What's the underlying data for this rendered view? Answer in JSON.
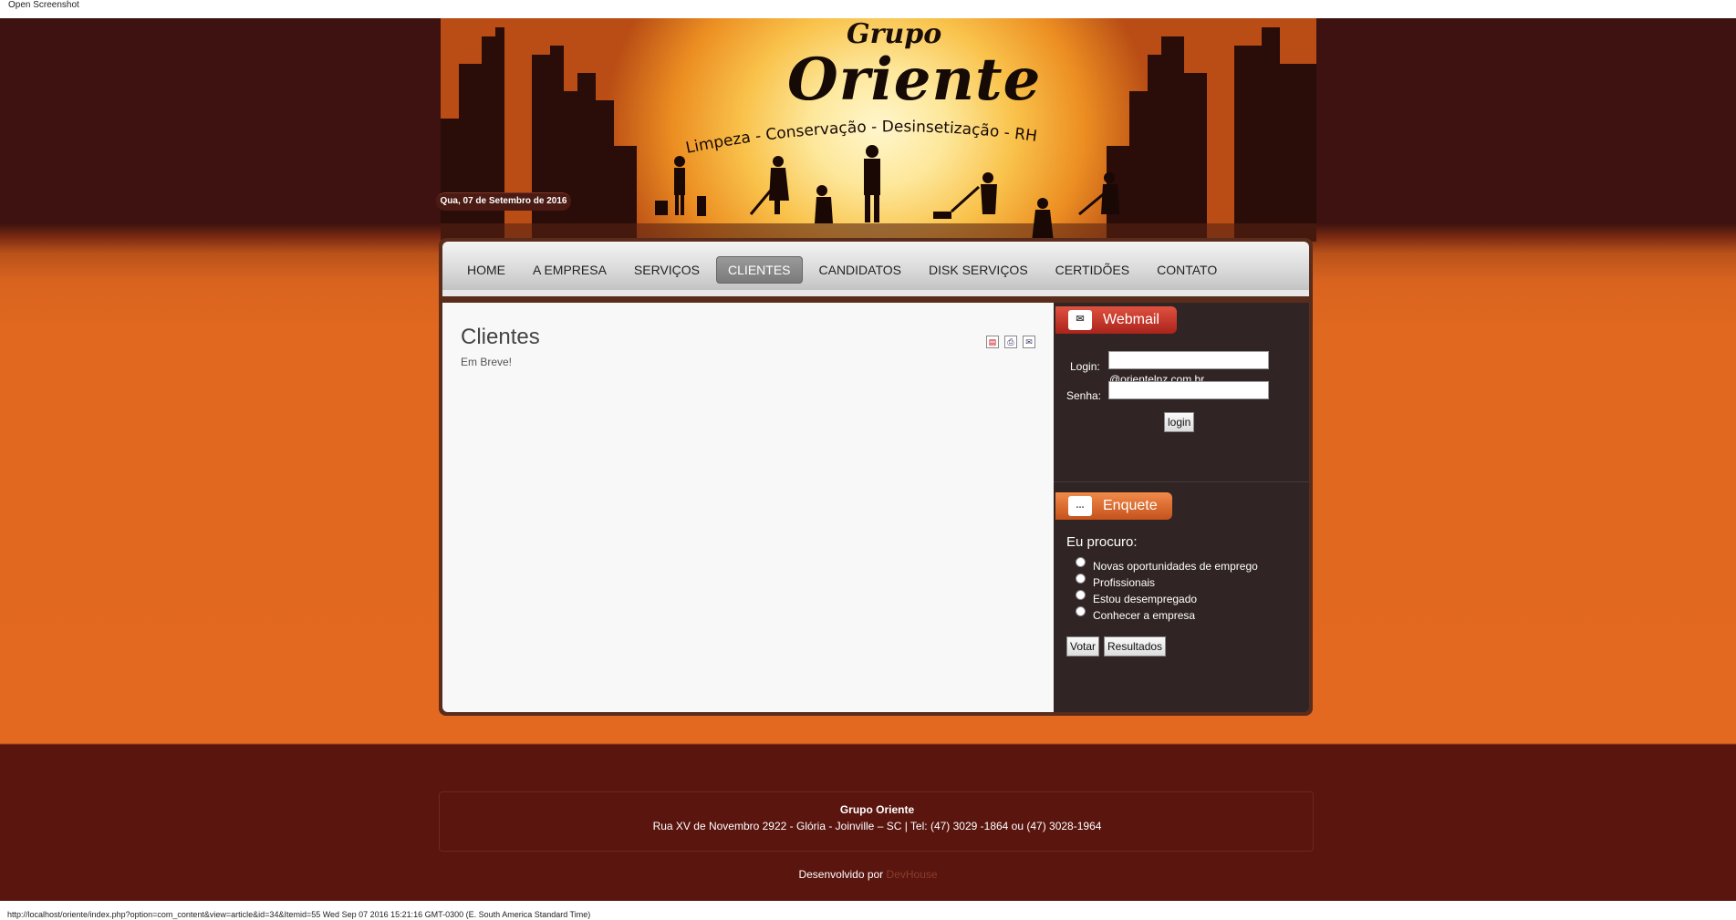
{
  "window": {
    "title": "Open Screenshot"
  },
  "header": {
    "brand_small": "Grupo",
    "brand_big": "Oriente",
    "tagline": "Limpeza - Conservação - Desinsetização - RH",
    "date": "Qua, 07 de Setembro de 2016"
  },
  "nav": {
    "items": [
      {
        "label": "HOME"
      },
      {
        "label": "A EMPRESA"
      },
      {
        "label": "SERVIÇOS"
      },
      {
        "label": "CLIENTES",
        "active": true
      },
      {
        "label": "CANDIDATOS"
      },
      {
        "label": "DISK SERVIÇOS"
      },
      {
        "label": "CERTIDÕES"
      },
      {
        "label": "CONTATO"
      }
    ]
  },
  "main": {
    "title": "Clientes",
    "text": "Em Breve!",
    "tools": [
      "pdf-icon",
      "print-icon",
      "email-icon"
    ]
  },
  "webmail": {
    "heading": "Webmail",
    "login_label": "Login:",
    "domain": "@orientelpz.com.br",
    "password_label": "Senha:",
    "login_value": "",
    "password_value": "",
    "button": "login"
  },
  "poll": {
    "heading": "Enquete",
    "question": "Eu procuro:",
    "options": [
      "Novas oportunidades de emprego",
      "Profissionais",
      "Estou desempregado",
      "Conhecer a empresa"
    ],
    "vote_button": "Votar",
    "results_button": "Resultados"
  },
  "footer": {
    "title": "Grupo Oriente",
    "address": "Rua XV de Novembro 2922 - Glória - Joinville – SC | Tel: (47) 3029 -1864 ou (47) 3028-1964",
    "developed_by": "Desenvolvido por",
    "developer": "DevHouse"
  },
  "status": {
    "text": "http://localhost/oriente/index.php?option=com_content&view=article&id=34&Itemid=55 Wed Sep 07 2016 15:21:16 GMT-0300 (E. South America Standard Time)"
  },
  "colors": {
    "dark_maroon": "#3d1210",
    "orange": "#e2691f",
    "sidebar": "#302424",
    "webmail_red": "#c0392b",
    "enquete_orange": "#e0783a"
  }
}
